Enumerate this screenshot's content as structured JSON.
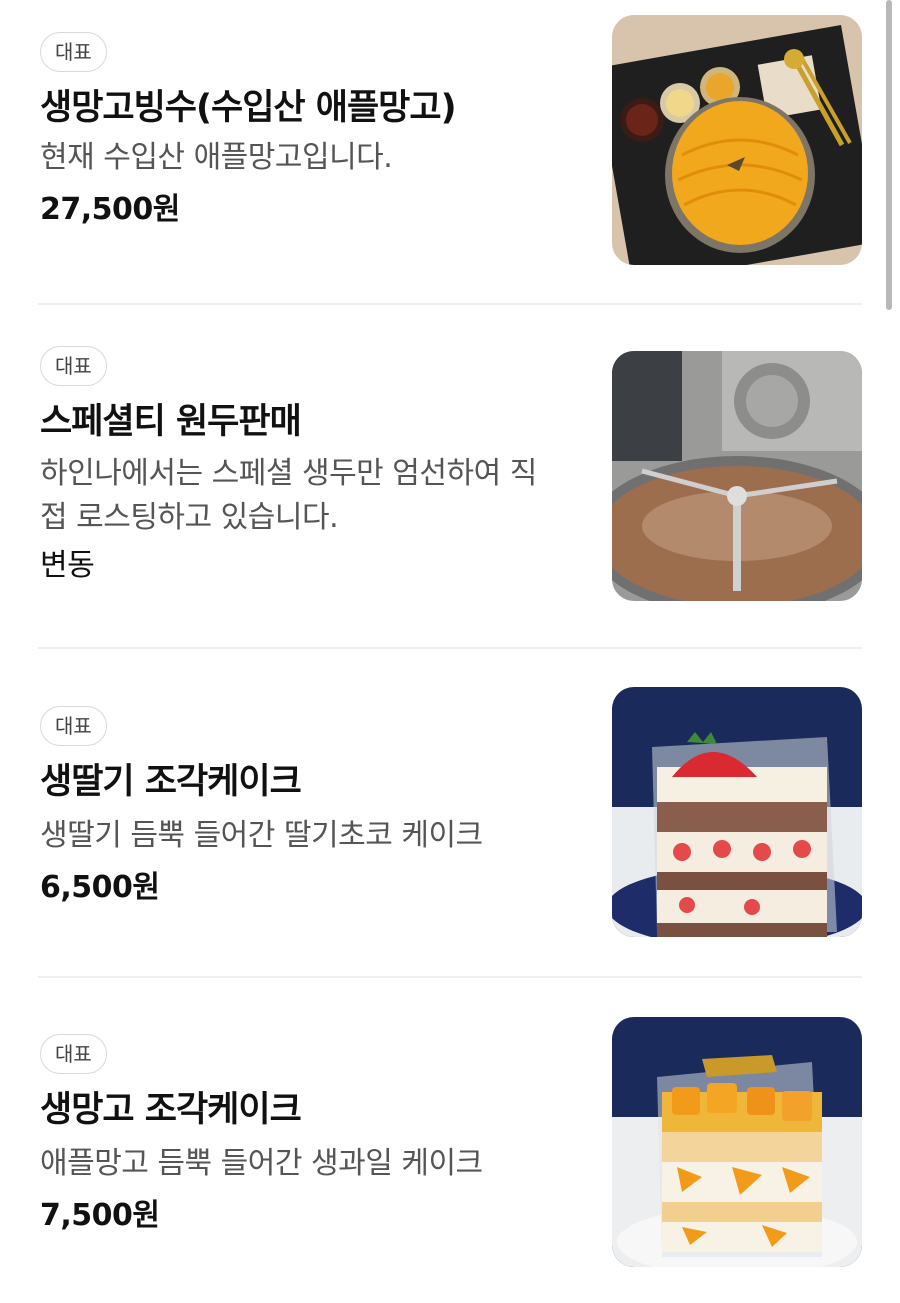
{
  "menu": {
    "items": [
      {
        "badge": "대표",
        "name": "생망고빙수(수입산 애플망고)",
        "description": "현재 수입산 애플망고입니다.",
        "price": "27,500원",
        "image_icon": "mango-bingsu-photo"
      },
      {
        "badge": "대표",
        "name": "스페셜티 원두판매",
        "description": "하인나에서는 스페셜 생두만 엄선하여 직접 로스팅하고 있습니다.",
        "price": "변동",
        "image_icon": "coffee-roaster-photo"
      },
      {
        "badge": "대표",
        "name": "생딸기 조각케이크",
        "description": "생딸기 듬뿍 들어간 딸기초코 케이크",
        "price": "6,500원",
        "image_icon": "strawberry-cake-photo"
      },
      {
        "badge": "대표",
        "name": "생망고 조각케이크",
        "description": "애플망고 듬뿍 들어간 생과일 케이크",
        "price": "7,500원",
        "image_icon": "mango-cake-photo"
      }
    ]
  }
}
